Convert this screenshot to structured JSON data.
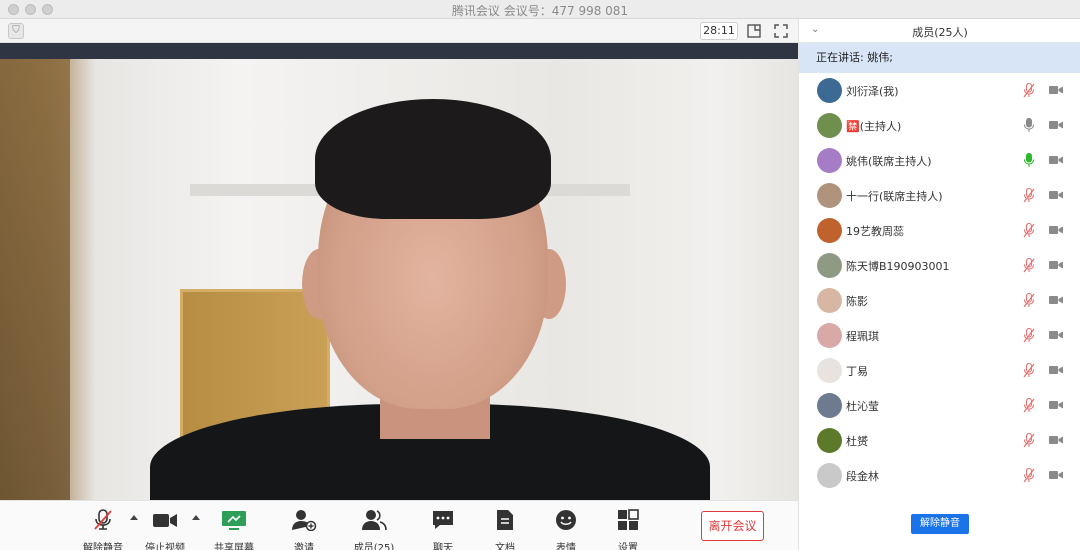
{
  "window": {
    "title": "腾讯会议 会议号：477 998 081"
  },
  "toolbar": {
    "timer": "28:11",
    "shield_icon": "shield-icon",
    "layout_icon": "layout-icon",
    "fullscreen_icon": "fullscreen-icon"
  },
  "controls": {
    "unmute": "解除静音",
    "stop_video": "停止视频",
    "share_screen": "共享屏幕",
    "invite": "邀请",
    "members": "成员(25)",
    "chat": "聊天",
    "docs": "文档",
    "emoji": "表情",
    "settings": "设置",
    "leave": "离开会议"
  },
  "panel": {
    "title": "成员(25人)",
    "speaking": "正在讲话: 姚伟;",
    "unmute_button": "解除静音",
    "members": [
      {
        "name": "刘衍泽(我)",
        "mic": "muted",
        "color": "#3d6a94"
      },
      {
        "name": "🈲(主持人)",
        "mic": "on",
        "color": "#6f8f4e"
      },
      {
        "name": "姚伟(联席主持人)",
        "mic": "speaking",
        "color": "#a67cc7"
      },
      {
        "name": "十一行(联席主持人)",
        "mic": "muted",
        "color": "#b0937c"
      },
      {
        "name": "19艺教周蕊",
        "mic": "muted",
        "color": "#c0622e"
      },
      {
        "name": "陈天博B190903001",
        "mic": "muted",
        "color": "#8f9a84"
      },
      {
        "name": "陈影",
        "mic": "muted",
        "color": "#d7b6a4"
      },
      {
        "name": "程珮琪",
        "mic": "muted",
        "color": "#d8a9a6"
      },
      {
        "name": "丁易",
        "mic": "muted",
        "color": "#e9e3df"
      },
      {
        "name": "杜沁莹",
        "mic": "muted",
        "color": "#6d7a8f"
      },
      {
        "name": "杜赟",
        "mic": "muted",
        "color": "#5c7a2a"
      },
      {
        "name": "段金林",
        "mic": "muted",
        "color": "#c9c9c9"
      }
    ]
  },
  "colors": {
    "accent": "#1a73e8",
    "muted_mic": "#e57373",
    "speaking_mic": "#2eb82e",
    "leave": "#e03b3b"
  }
}
